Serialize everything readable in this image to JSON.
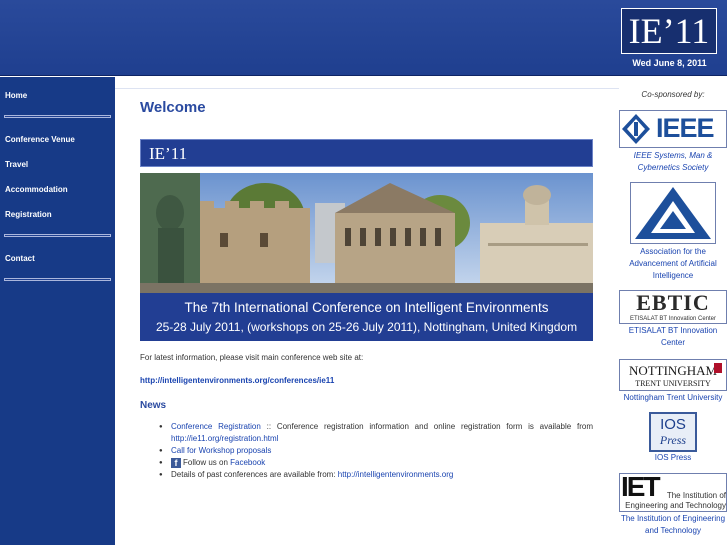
{
  "header": {
    "logo_text": "IE’11",
    "date": "Wed June 8, 2011"
  },
  "nav": {
    "items": [
      {
        "label": "Home"
      },
      {
        "label": "Conference Venue"
      },
      {
        "label": "Travel"
      },
      {
        "label": "Accommodation"
      },
      {
        "label": "Registration"
      },
      {
        "label": "Contact"
      }
    ]
  },
  "main": {
    "heading": "Welcome",
    "banner_title": "IE’11",
    "banner_caption_line1": "The 7th International Conference on Intelligent Environments",
    "banner_caption_line2": "25-28 July 2011, (workshops on 25-26 July 2011), Nottingham, United Kingdom",
    "latest_info": "For latest information, please visit main conference web site at:",
    "conference_link": "http://intelligentenvironments.org/conferences/ie11",
    "news_heading": "News",
    "news": {
      "reg_link": "Conference Registration",
      "reg_text": " :: Conference registration information and online registration form is available from ",
      "reg_url": "http://ie11.org/registration.html",
      "workshop_link": "Call for Workshop proposals",
      "fb_prefix": "Follow us on ",
      "fb_link": "Facebook",
      "past_text": "Details of past conferences are available from: ",
      "past_link": "http://intelligentenvironments.org"
    }
  },
  "sidebar": {
    "title": "Co-sponsored by:",
    "sponsors": [
      {
        "logo": "IEEE",
        "caption": "IEEE Systems, Man & Cybernetics Society"
      },
      {
        "logo": "",
        "caption": "Association for the Advancement of Artificial Intelligence"
      },
      {
        "logo": "EBTIC",
        "logo_sub": "ETISALAT BT Innovation Center",
        "caption": "ETISALAT BT Innovation Center"
      },
      {
        "logo": "NOTTINGHAM",
        "logo_sub": "TRENT UNIVERSITY",
        "caption": "Nottingham Trent University"
      },
      {
        "logo": "IOS",
        "logo_sub": "Press",
        "caption": "IOS Press"
      },
      {
        "logo": "IET",
        "logo_sub": "The Institution of Engineering and Technology",
        "caption": "The Institution of Engineering and Technology"
      }
    ]
  },
  "colors": {
    "header_blue": "#1f3f8f",
    "nav_blue": "#173a87",
    "link_blue": "#1a44b0",
    "heading_blue": "#2a4aa0"
  }
}
